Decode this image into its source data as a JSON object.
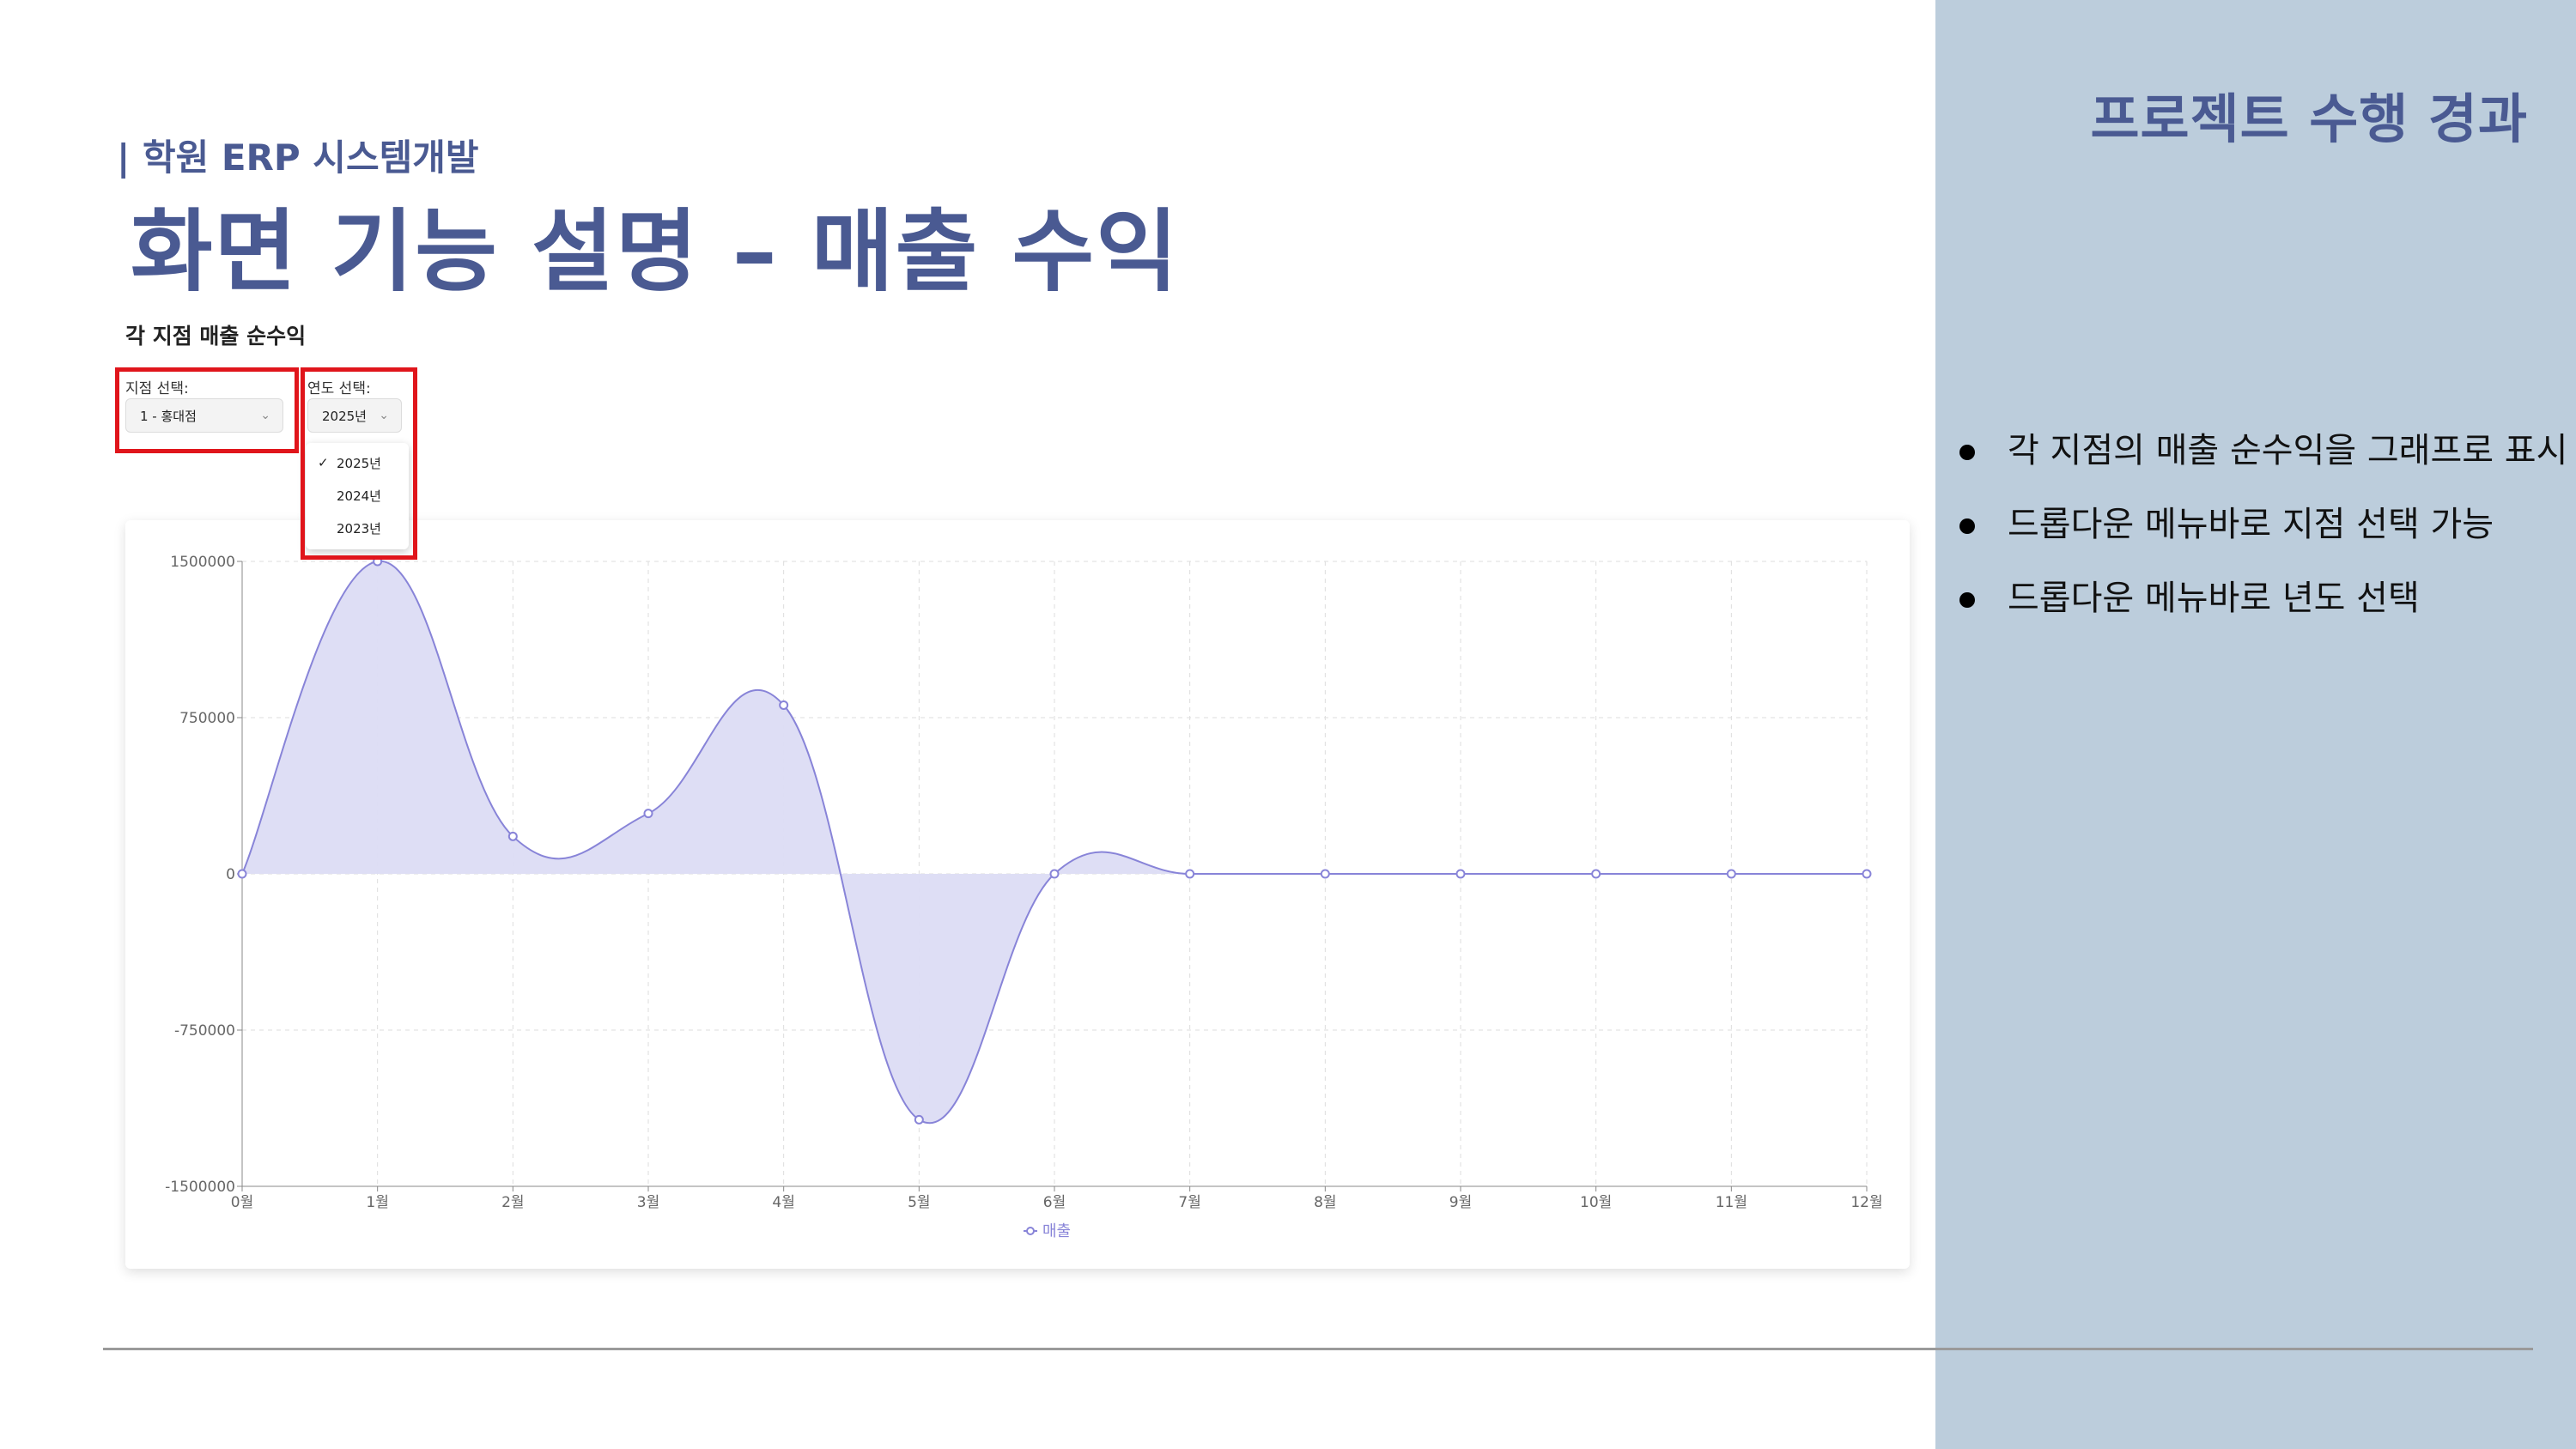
{
  "slide": {
    "section_title": "프로젝트 수행 경과",
    "subtitle": "| 학원 ERP 시스템개발",
    "title": "화면 기능 설명 – 매출 수익",
    "bullets": [
      "각 지점의 매출 순수익을 그래프로 표시",
      "드롭다운 메뉴바로 지점 선택 가능",
      "드롭다운 메뉴바로 년도 선택"
    ]
  },
  "app": {
    "heading": "각 지점 매출 순수익",
    "branch_select": {
      "label": "지점 선택:",
      "value": "1 - 홍대점"
    },
    "year_select": {
      "label": "연도 선택:",
      "value": "2025년",
      "options": [
        "2025년",
        "2024년",
        "2023년"
      ],
      "checked": "✓"
    }
  },
  "colors": {
    "accent": "#4a5a92",
    "panel": "#bccddc",
    "line": "#8884d8",
    "fill": "#dcdcf4",
    "highlight": "#e0151b"
  },
  "chart_data": {
    "type": "area",
    "x": [
      "0월",
      "1월",
      "2월",
      "3월",
      "4월",
      "5월",
      "6월",
      "7월",
      "8월",
      "9월",
      "10월",
      "11월",
      "12월"
    ],
    "series": [
      {
        "name": "매출",
        "values": [
          0,
          1500000,
          180000,
          290000,
          810000,
          -1180000,
          0,
          0,
          0,
          0,
          0,
          0,
          0
        ]
      }
    ],
    "y_ticks": [
      1500000,
      750000,
      0,
      -750000,
      -1500000
    ],
    "ylim": [
      -1500000,
      1500000
    ],
    "grid": true,
    "legend": "bottom"
  }
}
